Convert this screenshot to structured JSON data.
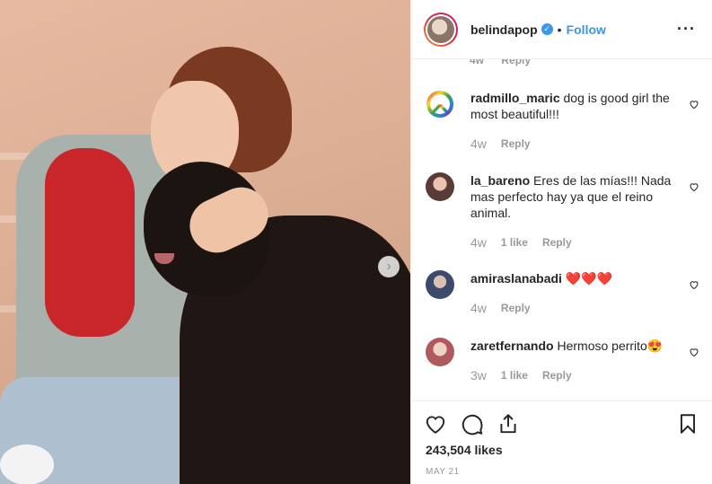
{
  "post": {
    "username": "belindapop",
    "verified_mark": "✓",
    "separator": "•",
    "follow_label": "Follow",
    "more_glyph": "···",
    "next_glyph": "›"
  },
  "partial_comment": {
    "time": "4w",
    "reply": "Reply"
  },
  "comments": [
    {
      "username": "radmillo_maric",
      "text": "dog is good girl the most beautiful!!!",
      "time": "4w",
      "likes": "",
      "reply": "Reply",
      "avatar": "peace-sign"
    },
    {
      "username": "la_bareno",
      "text": "Eres de las mías!!! Nada mas perfecto hay ya que el reino animal.",
      "time": "4w",
      "likes": "1 like",
      "reply": "Reply",
      "avatar": "photo"
    },
    {
      "username": "amiraslanabadi",
      "text": "❤️❤️❤️",
      "time": "4w",
      "likes": "",
      "reply": "Reply",
      "avatar": "photo"
    },
    {
      "username": "zaretfernando",
      "text": "Hermoso perrito😍",
      "time": "3w",
      "likes": "1 like",
      "reply": "Reply",
      "avatar": "photo"
    }
  ],
  "actions": {
    "like_icon": "heart-icon",
    "comment_icon": "comment-icon",
    "share_icon": "share-icon",
    "save_icon": "bookmark-icon"
  },
  "likes_count": "243,504 likes",
  "date": "MAY 21",
  "colors": {
    "accent": "#3897f0",
    "text": "#262626",
    "muted": "#999999"
  }
}
